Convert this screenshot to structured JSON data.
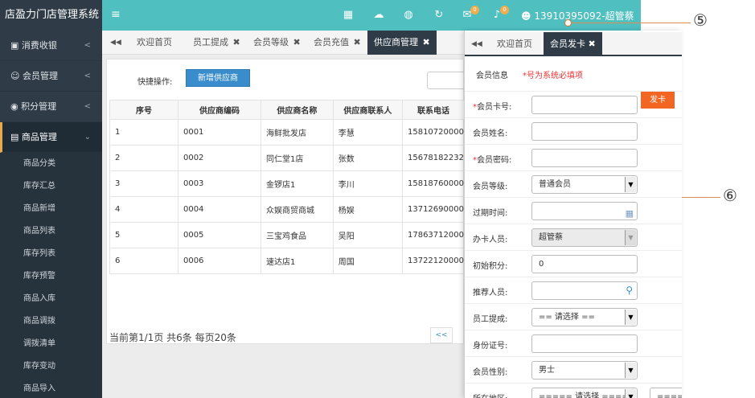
{
  "app": {
    "brand": "店盈力门店管理系统",
    "user": "13910395092-超管蔡"
  },
  "header_icons": [
    {
      "name": "grid-icon",
      "glyph": "▦"
    },
    {
      "name": "cloud-download-icon",
      "glyph": "☁"
    },
    {
      "name": "globe-icon",
      "glyph": "◍"
    },
    {
      "name": "refresh-icon",
      "glyph": "↻"
    },
    {
      "name": "mail-icon",
      "glyph": "✉",
      "badge": "0"
    },
    {
      "name": "bell-icon",
      "glyph": "♪",
      "badge": "0"
    }
  ],
  "annotations": {
    "five": "⑤",
    "six": "⑥"
  },
  "sidebar": {
    "items": [
      {
        "label": "消费收银",
        "icon": "▣",
        "arrow": "<"
      },
      {
        "label": "会员管理",
        "icon": "☺",
        "arrow": "<"
      },
      {
        "label": "积分管理",
        "icon": "◉",
        "arrow": "<"
      },
      {
        "label": "商品管理",
        "icon": "▤",
        "arrow": "⌄"
      }
    ],
    "sub_items": [
      "商品分类",
      "库存汇总",
      "商品新增",
      "商品列表",
      "库存列表",
      "库存预警",
      "商品入库",
      "商品调拨",
      "调拨清单",
      "库存变动",
      "商品导入"
    ]
  },
  "tabs": [
    {
      "label": "欢迎首页"
    },
    {
      "label": "员工提成"
    },
    {
      "label": "会员等级"
    },
    {
      "label": "会员充值"
    },
    {
      "label": "供应商管理"
    }
  ],
  "tab_nav": "◀◀",
  "quick": {
    "label": "快捷操作:",
    "button": "新增供应商"
  },
  "table": {
    "headers": [
      "序号",
      "供应商编码",
      "供应商名称",
      "供应商联系人",
      "联系电话"
    ],
    "rows": [
      [
        "1",
        "0001",
        "海鲜批发店",
        "李慧",
        "15810720000"
      ],
      [
        "2",
        "0002",
        "同仁堂1店",
        "张数",
        "15678182232"
      ],
      [
        "3",
        "0003",
        "金锣店1",
        "李川",
        "15818760000"
      ],
      [
        "4",
        "0004",
        "众娱商贸商城",
        "杨娱",
        "13712690000"
      ],
      [
        "5",
        "0005",
        "三宝鸡食品",
        "吴阳",
        "17863712000"
      ],
      [
        "6",
        "0006",
        "速达店1",
        "周国",
        "13722120000"
      ]
    ]
  },
  "pagination": {
    "info": "当前第1/1页 共6条 每页20条",
    "prev": "<<"
  },
  "modal": {
    "tabs": [
      {
        "label": "欢迎首页"
      },
      {
        "label": "会员发卡"
      }
    ],
    "section_title": "会员信息",
    "required_note": "*号为系统必填项",
    "issue_button": "发卡",
    "fields": [
      {
        "label": "会员卡号:",
        "required": true,
        "value": "",
        "type": "text"
      },
      {
        "label": "会员姓名:",
        "required": false,
        "value": "",
        "type": "text"
      },
      {
        "label": "会员密码:",
        "required": true,
        "value": "",
        "type": "text"
      },
      {
        "label": "会员等级:",
        "required": false,
        "value": "普通会员",
        "type": "select"
      },
      {
        "label": "过期时间:",
        "required": false,
        "value": "",
        "type": "date"
      },
      {
        "label": "办卡人员:",
        "required": false,
        "value": "超管蔡",
        "type": "select-disabled"
      },
      {
        "label": "初始积分:",
        "required": false,
        "value": "0",
        "type": "text"
      },
      {
        "label": "推荐人员:",
        "required": false,
        "value": "",
        "type": "search"
      },
      {
        "label": "员工提成:",
        "required": false,
        "value": "== 请选择 ==",
        "type": "select"
      },
      {
        "label": "身份证号:",
        "required": false,
        "value": "",
        "type": "text"
      },
      {
        "label": "会员性别:",
        "required": false,
        "value": "男士",
        "type": "select"
      },
      {
        "label": "所在地区:",
        "required": false,
        "value": "===== 请选择 =====",
        "type": "select",
        "extra": "===== 请选"
      }
    ]
  }
}
